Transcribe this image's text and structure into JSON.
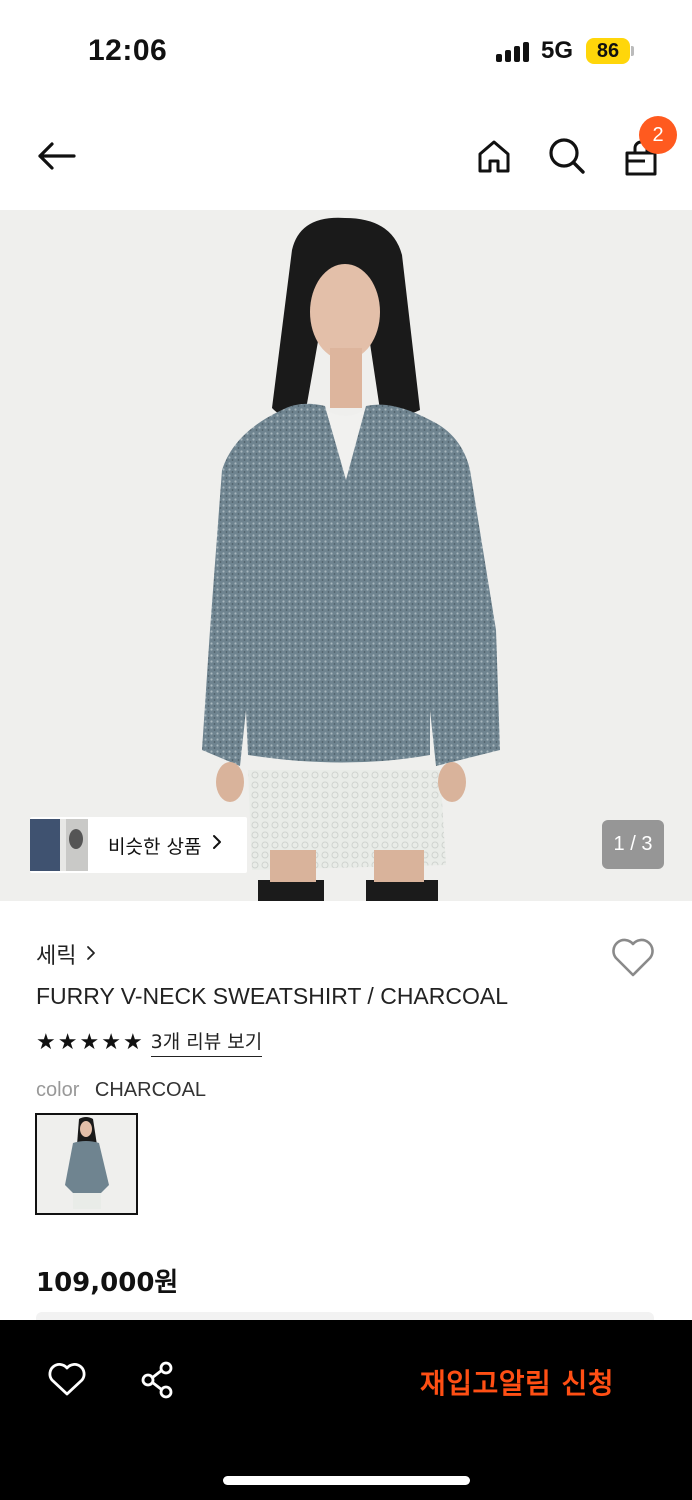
{
  "status_bar": {
    "time": "12:06",
    "network": "5G",
    "battery": "86"
  },
  "nav": {
    "cart_count": "2",
    "icons": [
      "arrow-left-icon",
      "home-icon",
      "search-icon",
      "shopping-bag-icon"
    ]
  },
  "gallery": {
    "similar_label": "비슷한 상품",
    "page_indicator": "1 / 3"
  },
  "product": {
    "brand": "세릭",
    "title": "FURRY V-NECK SWEATSHIRT / CHARCOAL",
    "rating_stars": 5,
    "review_link": "3개 리뷰 보기",
    "color_key": "color",
    "color_value": "CHARCOAL",
    "price": "109,000원"
  },
  "bottom_bar": {
    "restock_label": "재입고알림 신청",
    "restock_color": "#ff4f14"
  },
  "colors": {
    "accent": "#ff5a1f",
    "background": "#ffffff",
    "bottom_bar": "#000000"
  }
}
